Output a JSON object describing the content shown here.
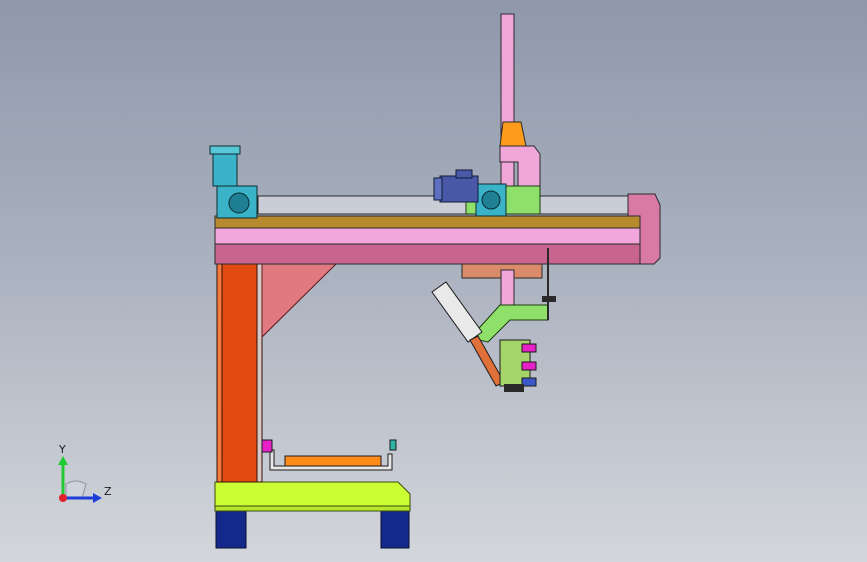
{
  "viewport": {
    "background_top": "#8f98ab",
    "background_bottom": "#d3d6db"
  },
  "model": {
    "parts": [
      "column-orange",
      "gusset-salmon",
      "beam-pink",
      "mast-pink",
      "motor-left-teal",
      "gearbox-left",
      "motor-top-blue",
      "gearbox-top",
      "carriage-green",
      "bracket-orange",
      "pneumatic-cylinder",
      "welding-head",
      "base-lime",
      "feet-navy",
      "fixture-orange"
    ],
    "colors": {
      "column": "#e24a12",
      "beam": "#d879a6",
      "beam_rail": "#c8a24a",
      "mast": "#f1a6d9",
      "gusset": "#e07a80",
      "motor_teal": "#3ab3c8",
      "motor_blue": "#4a58a8",
      "carriage": "#8fe06a",
      "bracket": "#ff9b1a",
      "base": "#ccff33",
      "feet": "#132a8a",
      "fixture": "#ff8c1a"
    }
  },
  "triad": {
    "y_label": "Y",
    "z_label": "Z",
    "y_color": "#1fcc2f",
    "z_color": "#1e3ed8",
    "origin_color": "#e0202a"
  }
}
